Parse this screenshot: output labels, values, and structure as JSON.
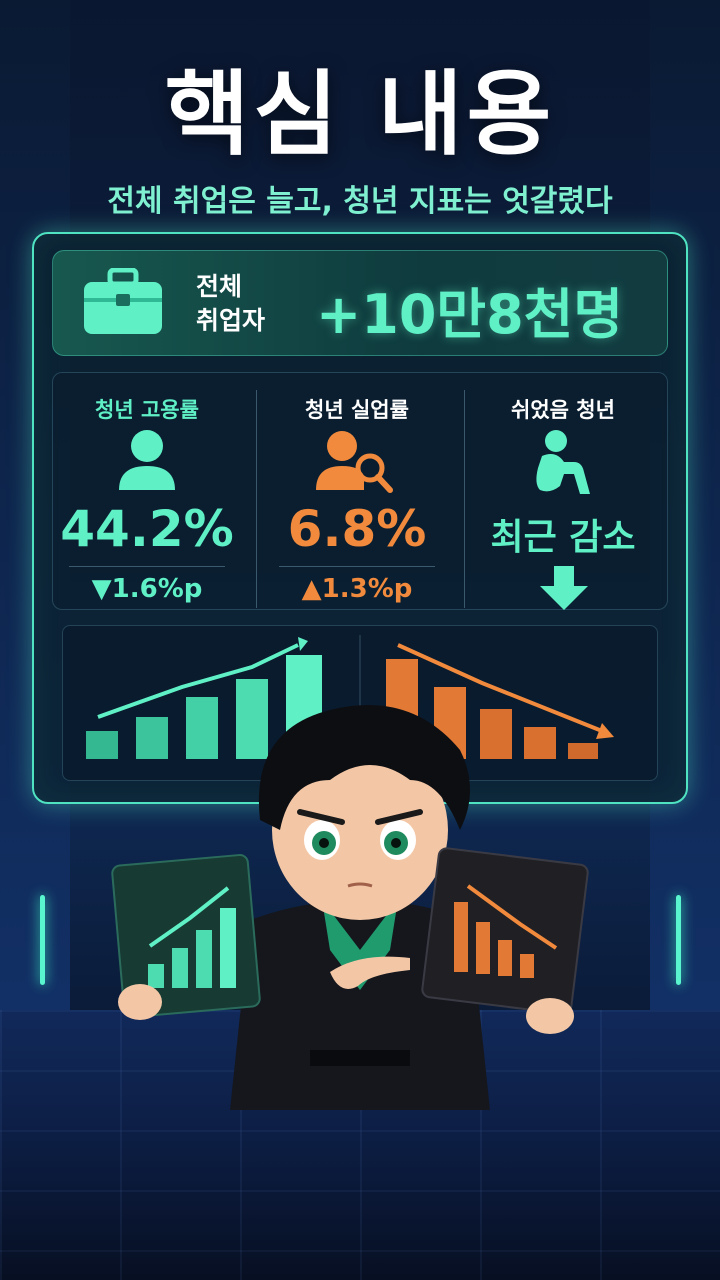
{
  "title": "핵심 내용",
  "subtitle": "전체 취업은 늘고, 청년 지표는 엇갈렸다",
  "total": {
    "label_line1": "전체",
    "label_line2": "취업자",
    "value": "+10만8천명",
    "icon": "briefcase-icon"
  },
  "stats": [
    {
      "label": "청년 고용률",
      "value": "44.2%",
      "delta": "▼1.6%p",
      "icon": "person-icon",
      "color": "#5ff0c6"
    },
    {
      "label": "청년 실업률",
      "value": "6.8%",
      "delta": "▲1.3%p",
      "icon": "person-search-icon",
      "color": "#f18a3c"
    },
    {
      "label": "쉬었음 청년",
      "value": "최근 감소",
      "icon": "sitting-person-icon",
      "arrow": "down-arrow-icon",
      "color": "#5ff0c6"
    }
  ],
  "colors": {
    "accent": "#5ff0c6",
    "warning": "#f18a3c",
    "background": "#0d1f3f"
  }
}
